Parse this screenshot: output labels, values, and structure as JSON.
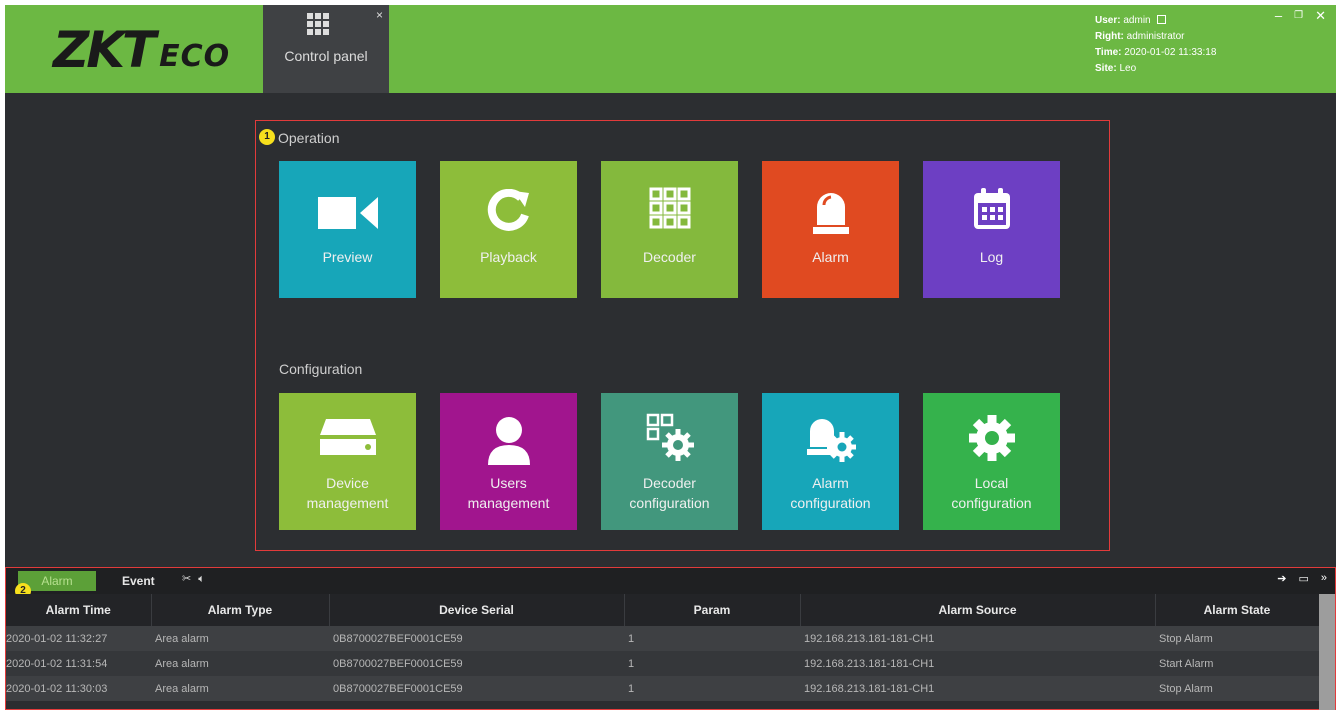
{
  "header": {
    "logo": {
      "zk": "ZKT",
      "eco": "ECO"
    },
    "tab": {
      "label": "Control panel",
      "close": "×"
    },
    "user": {
      "user_label": "User:",
      "user_value": "admin",
      "right_label": "Right:",
      "right_value": "administrator",
      "time_label": "Time:",
      "time_value": "2020-01-02 11:33:18",
      "site_label": "Site:",
      "site_value": "Leo"
    },
    "window_controls": {
      "minimize": "–",
      "restore": "❐",
      "close": "✕"
    }
  },
  "callouts": {
    "one": "1",
    "two": "2"
  },
  "operation": {
    "title": "Operation",
    "tiles": [
      {
        "label": "Preview",
        "color": "#17a6b9",
        "icon": "video-camera-icon"
      },
      {
        "label": "Playback",
        "color": "#8dbd3a",
        "icon": "refresh-icon"
      },
      {
        "label": "Decoder",
        "color": "#84b93d",
        "icon": "grid-icon"
      },
      {
        "label": "Alarm",
        "color": "#e04a21",
        "icon": "alarm-bell-icon"
      },
      {
        "label": "Log",
        "color": "#6d3fc3",
        "icon": "calendar-icon"
      }
    ]
  },
  "configuration": {
    "title": "Configuration",
    "tiles": [
      {
        "label1": "Device",
        "label2": "management",
        "color": "#8dbd3a",
        "icon": "server-icon"
      },
      {
        "label1": "Users",
        "label2": "management",
        "color": "#a1158e",
        "icon": "user-icon"
      },
      {
        "label1": "Decoder",
        "label2": "configuration",
        "color": "#42977d",
        "icon": "grid-gear-icon"
      },
      {
        "label1": "Alarm",
        "label2": "configuration",
        "color": "#17a6b9",
        "icon": "alarm-gear-icon"
      },
      {
        "label1": "Local",
        "label2": "configuration",
        "color": "#35b24c",
        "icon": "gear-icon"
      }
    ]
  },
  "bottom": {
    "tabs": {
      "alarm": "Alarm",
      "event": "Event"
    },
    "columns": [
      "Alarm Time",
      "Alarm Type",
      "Device Serial",
      "Param",
      "Alarm Source",
      "Alarm State"
    ],
    "rows": [
      [
        "2020-01-02 11:32:27",
        "Area alarm",
        "0B8700027BEF0001CE59",
        "1",
        "192.168.213.181-181-CH1",
        "Stop Alarm"
      ],
      [
        "2020-01-02 11:31:54",
        "Area alarm",
        "0B8700027BEF0001CE59",
        "1",
        "192.168.213.181-181-CH1",
        "Start Alarm"
      ],
      [
        "2020-01-02 11:30:03",
        "Area alarm",
        "0B8700027BEF0001CE59",
        "1",
        "192.168.213.181-181-CH1",
        "Stop Alarm"
      ]
    ]
  }
}
